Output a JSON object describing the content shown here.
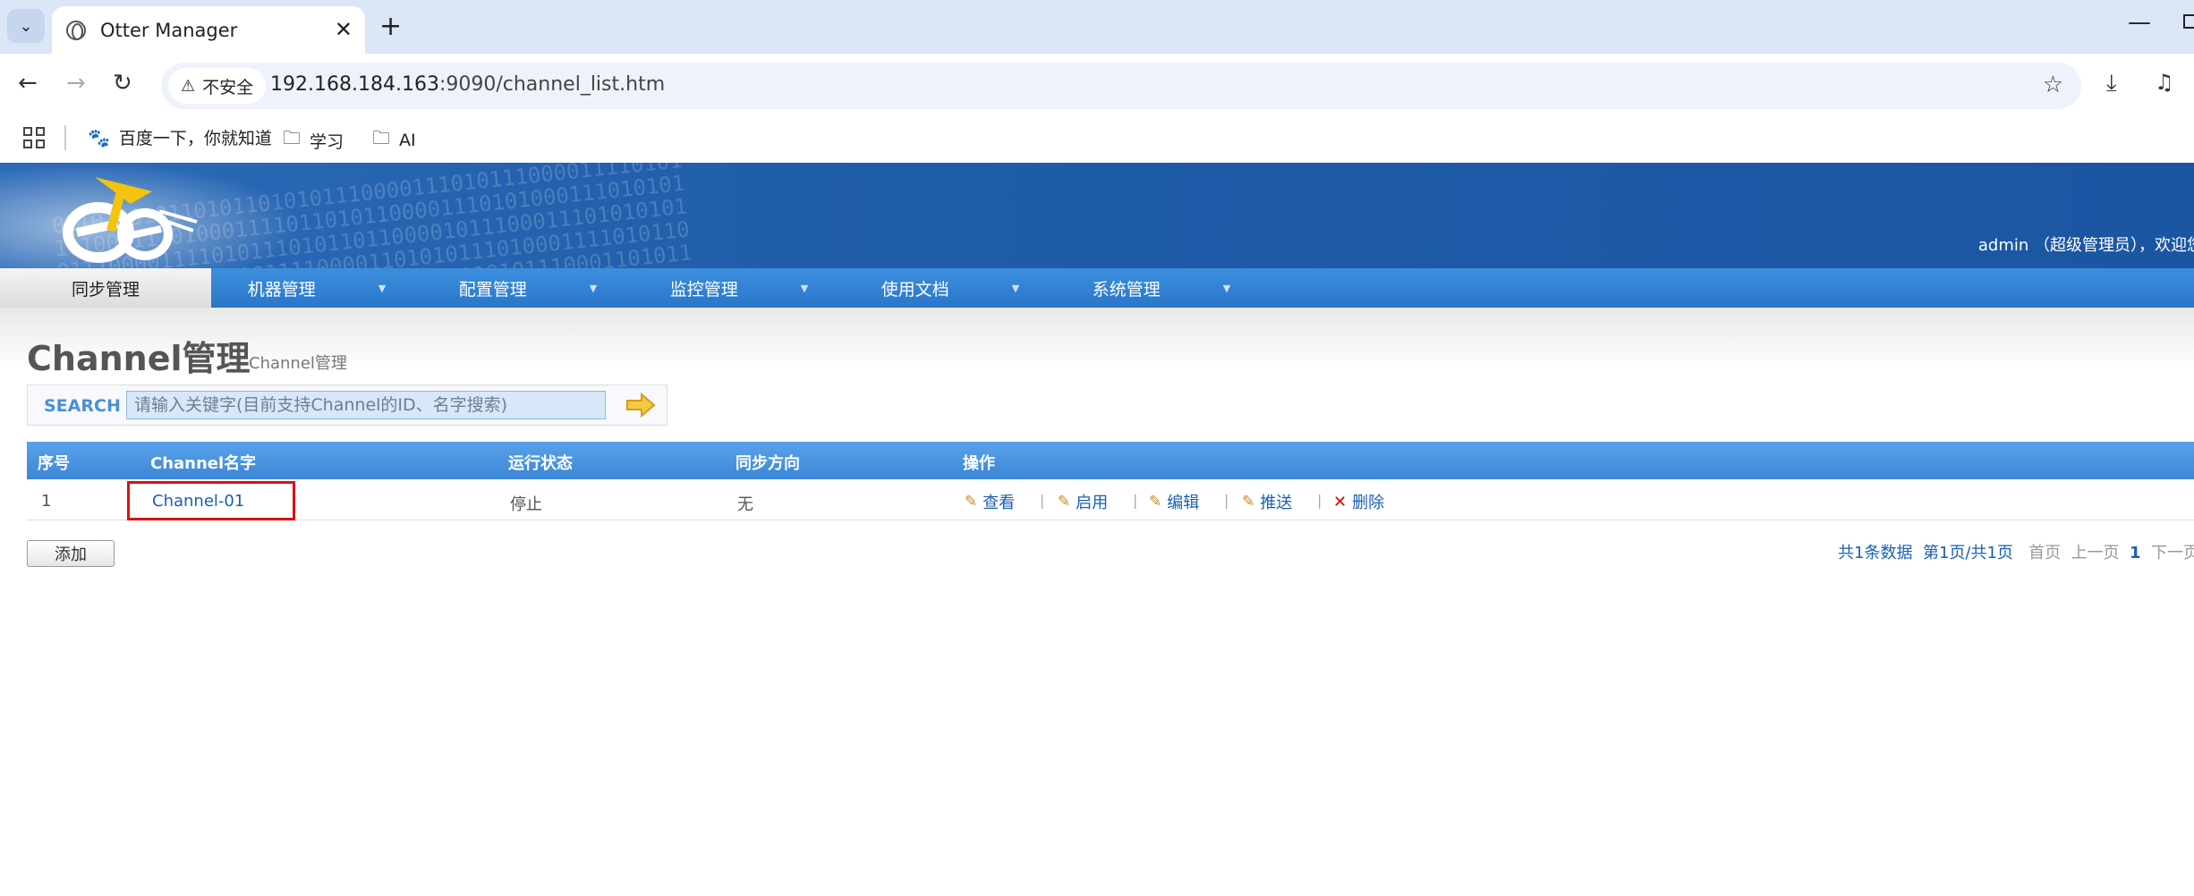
{
  "browser": {
    "tab_title": "Otter Manager",
    "security_label": "不安全",
    "url_host": "192.168.184.163",
    "url_path": ":9090/channel_list.htm",
    "bookmarks": [
      "百度一下，你就知道",
      "学习",
      "AI"
    ]
  },
  "header": {
    "user_info": "admin （超级管理员），欢迎您"
  },
  "nav": {
    "items": [
      "同步管理",
      "机器管理",
      "配置管理",
      "监控管理",
      "使用文档",
      "系统管理"
    ]
  },
  "page": {
    "title": "Channel管理",
    "subtitle": "Channel管理"
  },
  "search": {
    "label": "SEARCH",
    "placeholder": "请输入关键字(目前支持Channel的ID、名字搜索)"
  },
  "table": {
    "headers": [
      "序号",
      "Channel名字",
      "运行状态",
      "同步方向",
      "操作"
    ],
    "rows": [
      {
        "index": "1",
        "name": "Channel-01",
        "status": "停止",
        "direction": "无"
      }
    ],
    "actions": [
      "查看",
      "启用",
      "编辑",
      "推送",
      "删除"
    ]
  },
  "footer": {
    "add_label": "添加",
    "total": "共1条数据",
    "page_info": "第1页/共1页",
    "first": "首页",
    "prev": "上一页",
    "current": "1",
    "next": "下一页"
  },
  "colors": {
    "header_blue": "#1f5ca8",
    "nav_blue": "#3c8fde",
    "link_blue": "#1a5fb4",
    "highlight_red": "#e01010"
  }
}
